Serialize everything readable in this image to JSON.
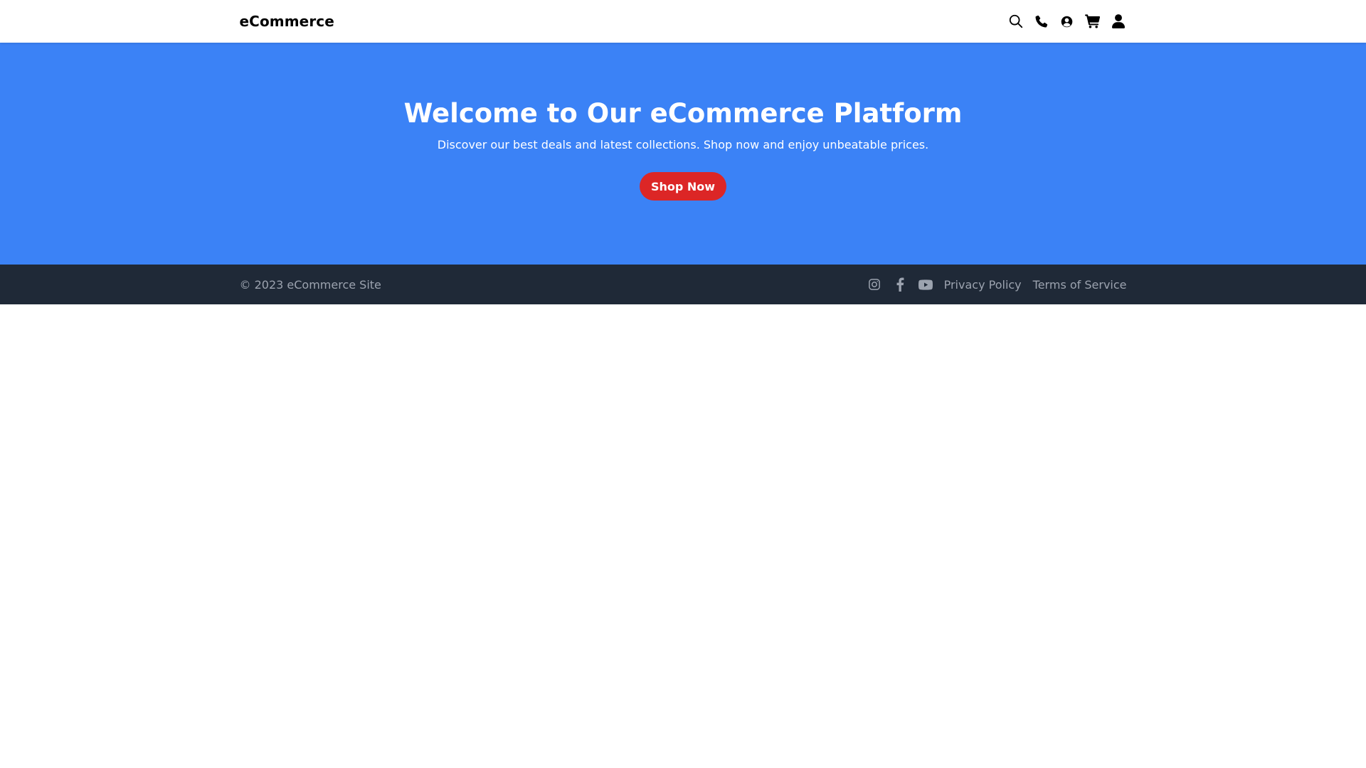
{
  "header": {
    "brand": "eCommerce",
    "icons": [
      "search-icon",
      "phone-icon",
      "user-circle-icon",
      "cart-icon",
      "user-icon"
    ]
  },
  "hero": {
    "title": "Welcome to Our eCommerce Platform",
    "subtitle": "Discover our best deals and latest collections. Shop now and enjoy unbeatable prices.",
    "cta_label": "Shop Now"
  },
  "footer": {
    "copyright": "© 2023 eCommerce Site",
    "social_icons": [
      "instagram-icon",
      "facebook-icon",
      "youtube-icon"
    ],
    "links": [
      "Privacy Policy",
      "Terms of Service"
    ]
  },
  "colors": {
    "hero_background": "#3b82f6",
    "cta_background": "#dc2626",
    "footer_background": "#1f2937",
    "footer_text": "#9ca3af"
  }
}
